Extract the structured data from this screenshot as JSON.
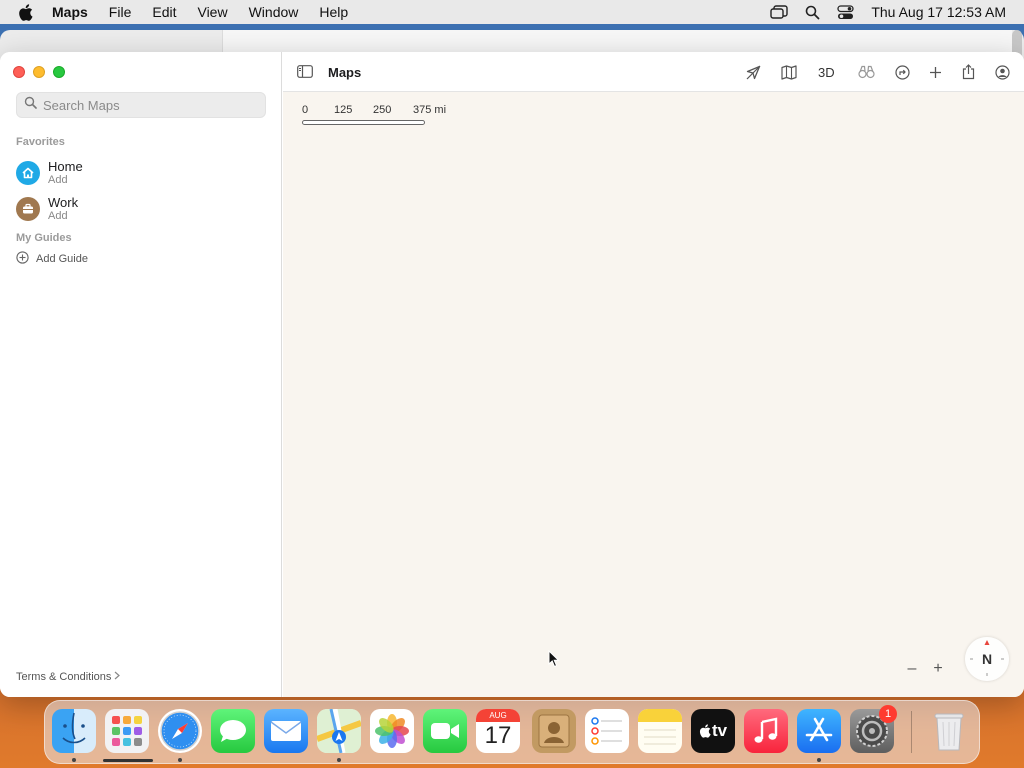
{
  "menubar": {
    "app_name": "Maps",
    "items": [
      "File",
      "Edit",
      "View",
      "Window",
      "Help"
    ],
    "clock": "Thu Aug 17  12:53 AM"
  },
  "window": {
    "title": "Maps"
  },
  "sidebar": {
    "search_placeholder": "Search Maps",
    "favorites_title": "Favorites",
    "favorites": [
      {
        "name": "Home",
        "action": "Add",
        "icon": "house-icon",
        "color": "#1fa9e6"
      },
      {
        "name": "Work",
        "action": "Add",
        "icon": "briefcase-icon",
        "color": "#a0784f"
      }
    ],
    "guides_title": "My Guides",
    "add_guide_label": "Add Guide",
    "terms_label": "Terms & Conditions"
  },
  "toolbar": {
    "three_d_label": "3D",
    "icons": [
      "location-arrow-icon",
      "map-mode-icon",
      "look-around-icon",
      "route-icon",
      "add-icon",
      "share-icon",
      "account-icon"
    ]
  },
  "map": {
    "scale_labels": [
      "0",
      "125",
      "250",
      "375 mi"
    ],
    "zoom_out_label": "–",
    "zoom_in_label": "+",
    "compass_label": "N"
  },
  "dock": {
    "calendar_month": "AUG",
    "calendar_day": "17",
    "appletv_label": "tv",
    "settings_badge": "1",
    "apps": [
      "Finder",
      "Launchpad",
      "Safari",
      "Messages",
      "Mail",
      "Maps",
      "Photos",
      "FaceTime",
      "Calendar",
      "Contacts",
      "Reminders",
      "Notes",
      "Apple TV",
      "Music",
      "App Store",
      "System Settings",
      "Trash"
    ]
  }
}
